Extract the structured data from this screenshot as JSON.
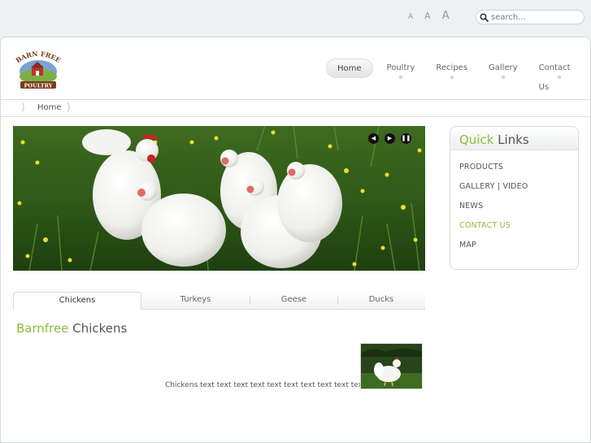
{
  "topbar": {
    "font_sizes": [
      "A",
      "A",
      "A"
    ],
    "search_placeholder": "search..."
  },
  "logo": {
    "line1": "BARN FREE",
    "line2": "POULTRY"
  },
  "nav": {
    "items": [
      "Home",
      "Poultry",
      "Recipes",
      "Gallery",
      "Contact Us"
    ],
    "active": "Home"
  },
  "breadcrumb": {
    "home": "Home"
  },
  "slider": {
    "controls": [
      "prev-icon",
      "next-icon",
      "pause-icon"
    ]
  },
  "tabs": {
    "items": [
      "Chickens",
      "Turkeys",
      "Geese",
      "Ducks"
    ],
    "active": "Chickens"
  },
  "content": {
    "title_accent": "Barnfree",
    "title_rest": "Chickens",
    "text": "Chickens text text text text text text text text text text"
  },
  "quick_links": {
    "title_accent": "Quick",
    "title_rest": "Links",
    "items": [
      "PRODUCTS",
      "GALLERY | VIDEO",
      "NEWS",
      "CONTACT US",
      "MAP"
    ],
    "highlighted": "CONTACT US"
  },
  "colors": {
    "accent": "#8bbd3e",
    "page_bg": "#eef0f1",
    "text": "#555555"
  }
}
